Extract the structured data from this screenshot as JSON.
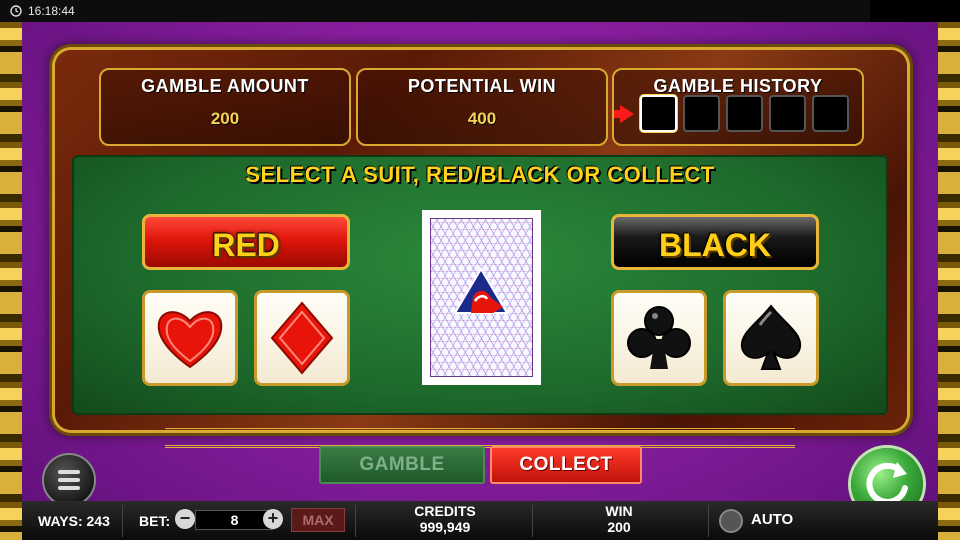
{
  "status_bar": {
    "time": "16:18:44"
  },
  "info": {
    "gamble_amount_label": "GAMBLE AMOUNT",
    "gamble_amount_value": "200",
    "potential_win_label": "POTENTIAL WIN",
    "potential_win_value": "400",
    "gamble_history_label": "GAMBLE HISTORY"
  },
  "board": {
    "instruction": "SELECT A SUIT, RED/BLACK OR COLLECT",
    "red_label": "RED",
    "black_label": "BLACK",
    "suits": [
      "heart-icon",
      "diamond-icon",
      "club-icon",
      "spade-icon"
    ]
  },
  "controls": {
    "gamble_label": "GAMBLE",
    "collect_label": "COLLECT"
  },
  "infobar": {
    "ways_label": "WAYS:",
    "ways_value": "243",
    "bet_label": "BET:",
    "bet_value": "8",
    "max_label": "MAX",
    "credits_label": "CREDITS",
    "credits_value": "999,949",
    "win_label": "WIN",
    "win_value": "200",
    "auto_label": "AUTO"
  },
  "colors": {
    "accent_gold": "#f6d25a",
    "red": "#e0150a",
    "green": "#1e6a2c"
  }
}
